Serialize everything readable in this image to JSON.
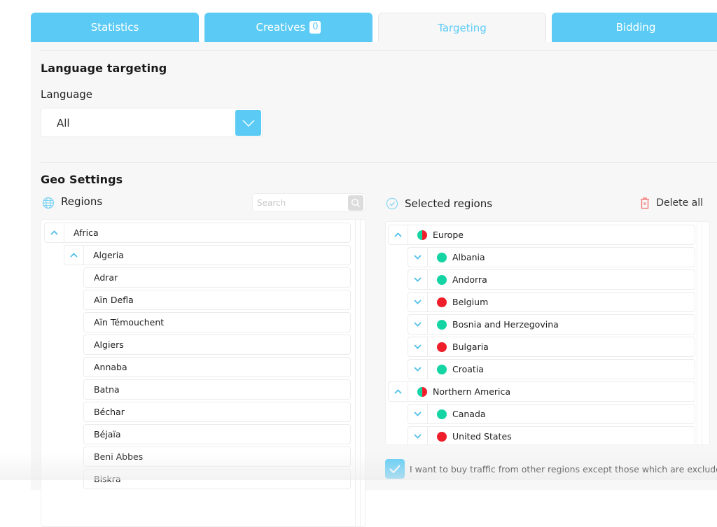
{
  "tabs": [
    {
      "label": "Statistics",
      "active": false
    },
    {
      "label": "Creatives",
      "badge": "0",
      "active": false
    },
    {
      "label": "Targeting",
      "active": true
    },
    {
      "label": "Bidding",
      "active": false
    }
  ],
  "language_section": {
    "title": "Language targeting",
    "field_label": "Language",
    "selected_value": "All"
  },
  "geo_section": {
    "title": "Geo Settings",
    "regions": {
      "title": "Regions",
      "search_placeholder": "Search",
      "tree": [
        {
          "label": "Africa",
          "level": 0,
          "expanded": true
        },
        {
          "label": "Algeria",
          "level": 1,
          "expanded": true
        },
        {
          "label": "Adrar",
          "level": 2
        },
        {
          "label": "Aïn Defla",
          "level": 2
        },
        {
          "label": "Aïn Témouchent",
          "level": 2
        },
        {
          "label": "Algiers",
          "level": 2
        },
        {
          "label": "Annaba",
          "level": 2
        },
        {
          "label": "Batna",
          "level": 2
        },
        {
          "label": "Béchar",
          "level": 2
        },
        {
          "label": "Béjaïa",
          "level": 2
        },
        {
          "label": "Beni Abbes",
          "level": 2
        },
        {
          "label": "Biskra",
          "level": 2
        }
      ]
    },
    "selected_regions": {
      "title": "Selected regions",
      "delete_all_label": "Delete all",
      "tree": [
        {
          "label": "Europe",
          "level": 0,
          "expanded": true,
          "status": "mixed"
        },
        {
          "label": "Albania",
          "level": 1,
          "status": "included"
        },
        {
          "label": "Andorra",
          "level": 1,
          "status": "included"
        },
        {
          "label": "Belgium",
          "level": 1,
          "status": "excluded"
        },
        {
          "label": "Bosnia and Herzegovina",
          "level": 1,
          "status": "included"
        },
        {
          "label": "Bulgaria",
          "level": 1,
          "status": "excluded"
        },
        {
          "label": "Croatia",
          "level": 1,
          "status": "included"
        },
        {
          "label": "Northern America",
          "level": 0,
          "expanded": true,
          "status": "mixed"
        },
        {
          "label": "Canada",
          "level": 1,
          "status": "included"
        },
        {
          "label": "United States",
          "level": 1,
          "status": "excluded"
        }
      ]
    },
    "other_regions_checkbox": {
      "label": "I want to buy traffic from other regions except those which are excluded",
      "checked": true
    }
  },
  "colors": {
    "accent": "#5bcbf5",
    "included": "#14d4a4",
    "excluded": "#ef1e2b",
    "delete": "#f26d6d"
  }
}
